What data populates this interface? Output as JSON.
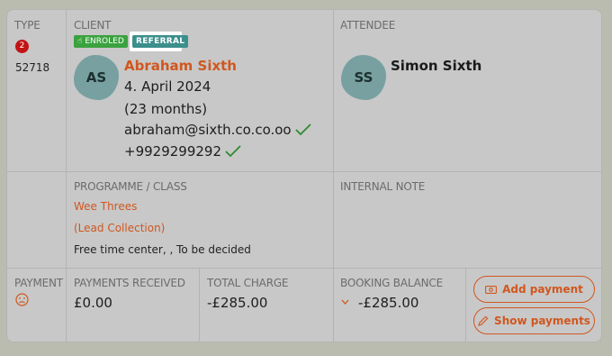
{
  "type_col": {
    "label": "TYPE",
    "count": "2",
    "ref_number": "52718"
  },
  "client": {
    "label": "CLIENT",
    "tags": {
      "enroled": "ENROLED",
      "referral": "REFERRAL"
    },
    "initials": "AS",
    "name": "Abraham Sixth",
    "dob": "4. April 2024",
    "age": "(23 months)",
    "email": "abraham@sixth.co.co.oo",
    "phone": "+9929299292"
  },
  "attendee": {
    "label": "ATTENDEE",
    "initials": "SS",
    "name": "Simon Sixth"
  },
  "programme": {
    "label": "PROGRAMME / CLASS",
    "class_name": "Wee Threes",
    "subtitle": "(Lead Collection)",
    "location": "Free time center, , To be decided"
  },
  "internal_note": {
    "label": "INTERNAL NOTE"
  },
  "payment": {
    "label": "PAYMENT",
    "received_label": "PAYMENTS RECEIVED",
    "received_value": "£0.00",
    "total_label": "TOTAL CHARGE",
    "total_value": "-£285.00",
    "balance_label": "BOOKING BALANCE",
    "balance_value": "-£285.00",
    "add_button": "Add payment",
    "show_button": "Show payments"
  },
  "colors": {
    "accent": "#d0571f",
    "danger": "#c21414",
    "teal": "#3b8f8c",
    "green": "#3aa23e"
  }
}
